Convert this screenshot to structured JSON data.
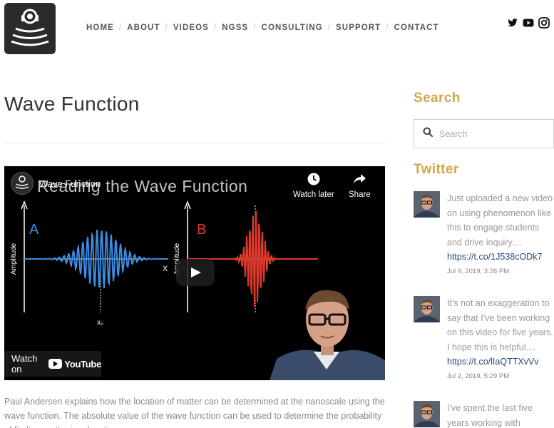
{
  "header": {
    "nav": [
      "HOME",
      "ABOUT",
      "VIDEOS",
      "NGSS",
      "CONSULTING",
      "SUPPORT",
      "CONTACT"
    ],
    "social_icons": [
      "twitter-icon",
      "youtube-icon",
      "instagram-icon"
    ]
  },
  "page": {
    "title": "Wave Function",
    "description": "Paul Andersen explains how the location of matter can be determined at the nanoscale using the wave function. The absolute value of the wave function can be used to determine the probability of finding matter in a location."
  },
  "video": {
    "title": "Wave Function",
    "subtitle": "Reading the Wave Function",
    "watch_later": "Watch later",
    "share": "Share",
    "watch_on": "Watch on",
    "youtube": "YouTube",
    "panel_a": "A",
    "panel_b": "B",
    "amplitude": "Amplitude",
    "x_label": "X",
    "x0_label": "x₀"
  },
  "sidebar": {
    "search_title": "Search",
    "search_placeholder": "Search",
    "twitter_title": "Twitter",
    "tweets": [
      {
        "text": "Just uploaded a new video on using phenomenon like this to engage students and drive inquiry....",
        "link": "https://t.co/1J538cODk7",
        "date": "Jul 9, 2019, 3:26 PM"
      },
      {
        "text": "It's not an exaggeration to say that I've been working on this video for five years. I hope this is helpful....",
        "link": "https://t.co/lIaQTTXvVv",
        "date": "Jul 2, 2019, 5:29 PM"
      },
      {
        "text": "I've spent the last five years working with",
        "link": "",
        "date": ""
      }
    ]
  },
  "colors": {
    "accent": "#d4a64b",
    "link": "#2d4a7a",
    "wave_a": "#3a8ee6",
    "wave_b": "#e0392b"
  }
}
